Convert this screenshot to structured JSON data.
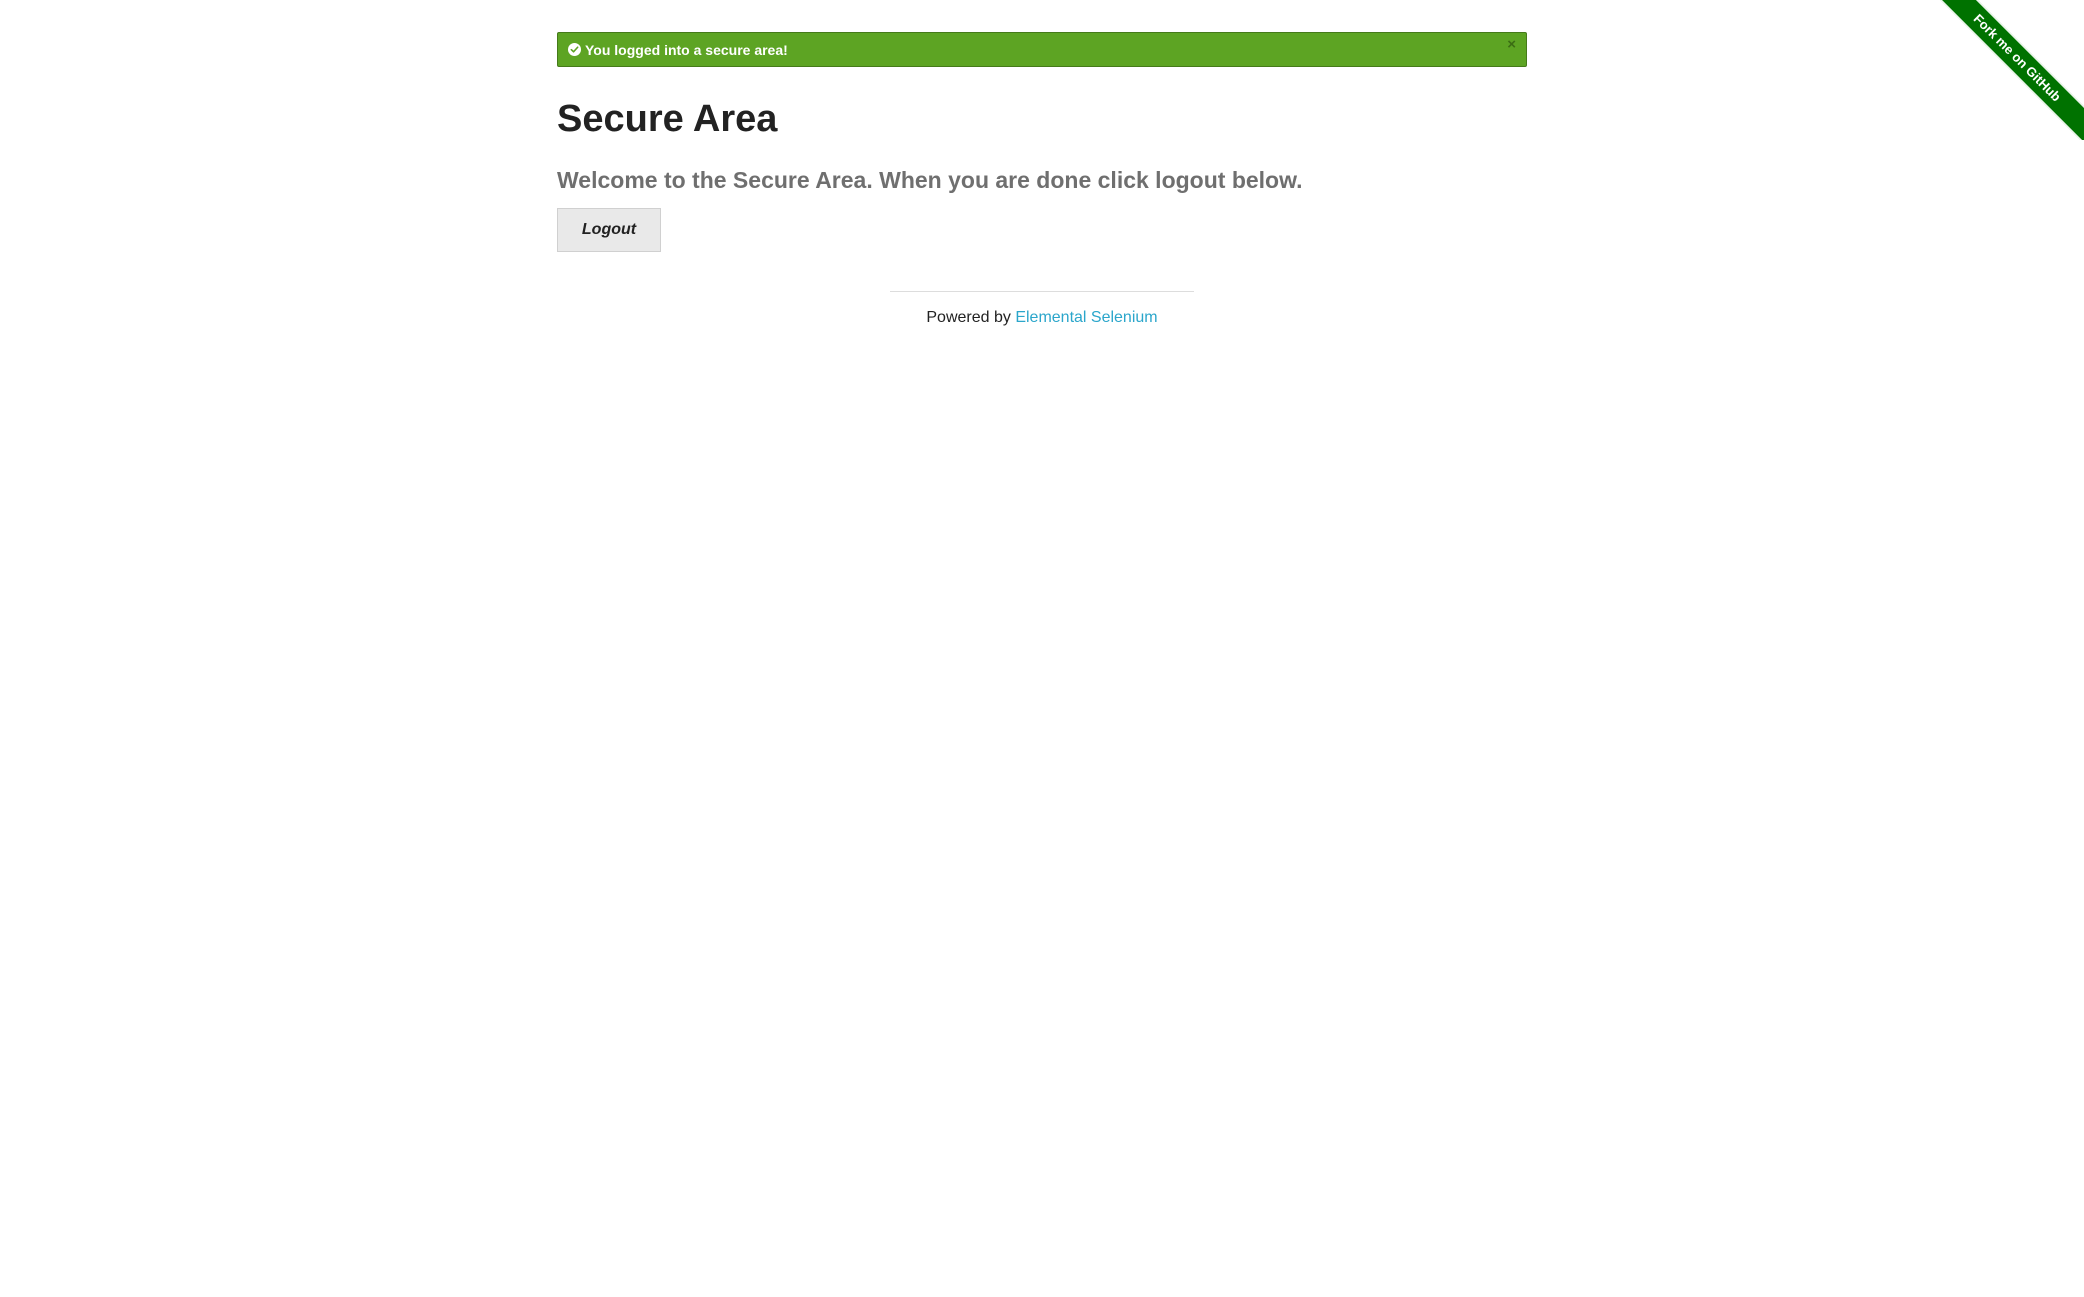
{
  "flash": {
    "message": "You logged into a secure area!",
    "close_label": "×",
    "color": "#5da423"
  },
  "main": {
    "title": "Secure Area",
    "subheader": "Welcome to the Secure Area. When you are done click logout below.",
    "logout_label": "Logout"
  },
  "footer": {
    "prefix": "Powered by ",
    "link_text": "Elemental Selenium"
  },
  "ribbon": {
    "label": "Fork me on GitHub",
    "color": "#007200"
  },
  "icons": {
    "flash_icon": "check-circle-icon",
    "close_icon": "close-icon"
  }
}
